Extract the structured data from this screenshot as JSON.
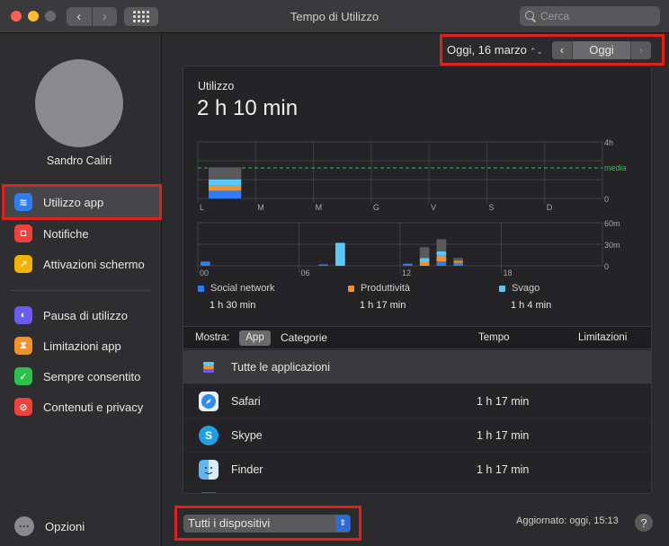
{
  "window": {
    "title": "Tempo di Utilizzo"
  },
  "toolbar": {
    "back_icon": "chevron-left-icon",
    "forward_icon": "chevron-right-icon",
    "grid_icon": "grid-icon",
    "search_placeholder": "Cerca"
  },
  "sidebar": {
    "username": "Sandro Caliri",
    "items": [
      {
        "label": "Utilizzo app",
        "icon": "layers-icon",
        "color": "#2f7df6",
        "selected": true
      },
      {
        "label": "Notifiche",
        "icon": "notification-icon",
        "color": "#f2413a"
      },
      {
        "label": "Attivazioni schermo",
        "icon": "pickup-icon",
        "color": "#f2b200"
      },
      {
        "label": "Pausa di utilizzo",
        "icon": "downtime-icon",
        "color": "#6a5cf0"
      },
      {
        "label": "Limitazioni app",
        "icon": "hourglass-icon",
        "color": "#f2922a"
      },
      {
        "label": "Sempre consentito",
        "icon": "check-shield-icon",
        "color": "#2fbf4f"
      },
      {
        "label": "Contenuti e privacy",
        "icon": "no-entry-icon",
        "color": "#f2413a"
      }
    ],
    "options_label": "Opzioni"
  },
  "date_control": {
    "date": "Oggi, 16 marzo",
    "today_label": "Oggi"
  },
  "usage": {
    "label": "Utilizzo",
    "total": "2 h 10 min",
    "average_label": "media"
  },
  "chart_data": [
    {
      "type": "bar",
      "title": "",
      "categories": [
        "L",
        "M",
        "M",
        "G",
        "V",
        "S",
        "D"
      ],
      "y_ticks": [
        "4h",
        "0"
      ],
      "average_line_label": "media",
      "series": [
        {
          "name": "Social network",
          "values": [
            0.55,
            0,
            0,
            0,
            0,
            0,
            0
          ]
        },
        {
          "name": "Produttività",
          "values": [
            0.35,
            0,
            0,
            0,
            0,
            0,
            0
          ]
        },
        {
          "name": "Svago",
          "values": [
            0.45,
            0,
            0,
            0,
            0,
            0,
            0
          ]
        },
        {
          "name": "",
          "values": [
            0.85,
            0,
            0,
            0,
            0,
            0,
            0
          ]
        }
      ],
      "stacked": true,
      "ylim": [
        0,
        4
      ],
      "unit": "h"
    },
    {
      "type": "bar",
      "title": "",
      "x_ticks": [
        "00",
        "06",
        "12",
        "18"
      ],
      "y_ticks": [
        "60m",
        "30m",
        "0"
      ],
      "stacked": true,
      "unit": "min",
      "ylim": [
        0,
        60
      ],
      "hours": [
        0,
        7,
        8,
        12,
        13,
        14,
        15
      ],
      "series": [
        {
          "name": "Social network",
          "values": [
            6,
            2,
            0,
            3,
            0,
            6,
            4
          ]
        },
        {
          "name": "Produttività",
          "values": [
            0,
            0,
            0,
            0,
            5,
            8,
            3
          ]
        },
        {
          "name": "Svago",
          "values": [
            0,
            0,
            32,
            0,
            6,
            6,
            0
          ]
        },
        {
          "name": "",
          "values": [
            0,
            0,
            0,
            0,
            15,
            17,
            4
          ]
        }
      ]
    }
  ],
  "legend": [
    {
      "name": "Social network",
      "color": "#2f7df6",
      "value": "1 h 30 min"
    },
    {
      "name": "Produttività",
      "color": "#f2922a",
      "value": "1 h 17 min"
    },
    {
      "name": "Svago",
      "color": "#5ac8fa",
      "value": "1 h 4 min"
    }
  ],
  "table": {
    "show_label": "Mostra:",
    "seg_app": "App",
    "seg_categories": "Categorie",
    "col_time": "Tempo",
    "col_limits": "Limitazioni",
    "rows": [
      {
        "name": "Tutte le applicazioni",
        "time": "",
        "icon": "layers-icon"
      },
      {
        "name": "Safari",
        "time": "1 h 17 min",
        "icon": "compass-icon"
      },
      {
        "name": "Skype",
        "time": "1 h 17 min",
        "icon": "skype-icon"
      },
      {
        "name": "Finder",
        "time": "1 h 17 min",
        "icon": "finder-icon"
      }
    ]
  },
  "footer": {
    "device": "Tutti i dispositivi",
    "updated": "Aggiornato: oggi, 15:13",
    "help": "?"
  }
}
